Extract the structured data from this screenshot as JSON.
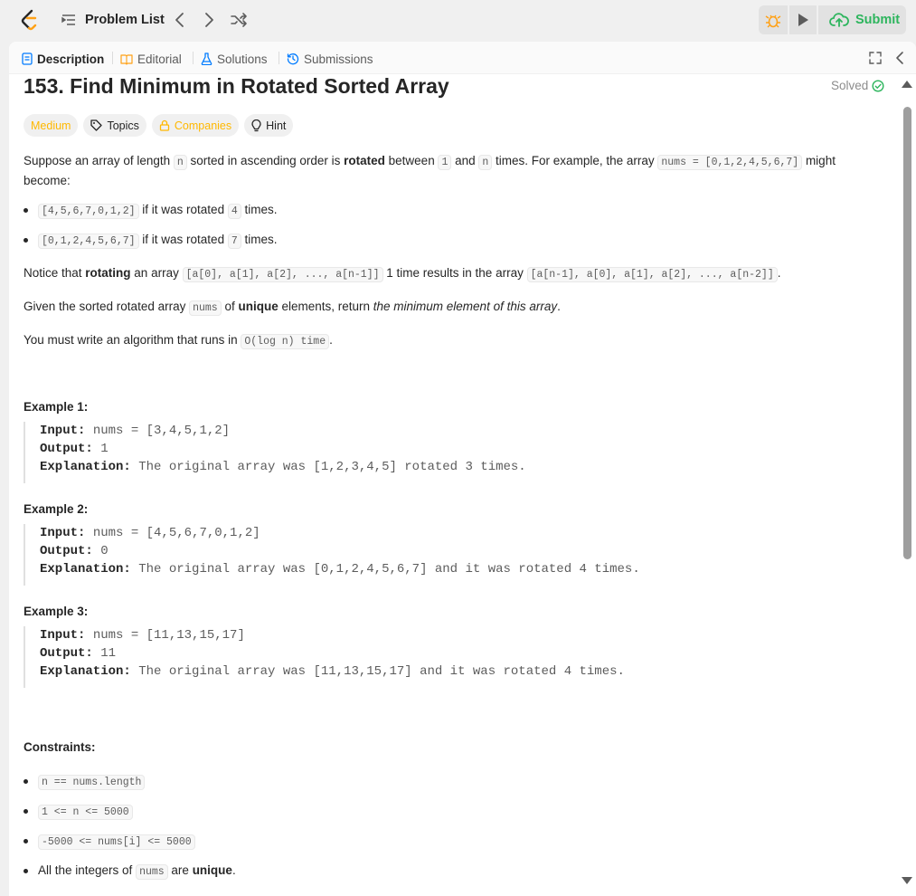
{
  "topbar": {
    "problem_list_label": "Problem List",
    "submit_label": "Submit",
    "submit_color": "#2db55d",
    "accent_color": "#ffa116"
  },
  "tabs": [
    {
      "label": "Description",
      "icon": "description-icon",
      "active": true
    },
    {
      "label": "Editorial",
      "icon": "book-icon"
    },
    {
      "label": "Solutions",
      "icon": "flask-icon"
    },
    {
      "label": "Submissions",
      "icon": "history-icon"
    }
  ],
  "problem": {
    "title": "153. Find Minimum in Rotated Sorted Array",
    "status": "Solved",
    "difficulty": "Medium",
    "topics_label": "Topics",
    "companies_label": "Companies",
    "hint_label": "Hint"
  },
  "description": {
    "p1": {
      "t1": "Suppose an array of length ",
      "c1": "n",
      "t2": " sorted in ascending order is ",
      "b1": "rotated",
      "t3": " between ",
      "c2": "1",
      "t4": " and ",
      "c3": "n",
      "t5": " times. For example, the array ",
      "c4": "nums = [0,1,2,4,5,6,7]",
      "t6": " might become:"
    },
    "bullets": [
      {
        "code": "[4,5,6,7,0,1,2]",
        "text": " if it was rotated ",
        "n": "4",
        "tail": " times."
      },
      {
        "code": "[0,1,2,4,5,6,7]",
        "text": " if it was rotated ",
        "n": "7",
        "tail": " times."
      }
    ],
    "p2": {
      "t1": "Notice that ",
      "b1": "rotating",
      "t2": " an array ",
      "c1": "[a[0], a[1], a[2], ..., a[n-1]]",
      "t3": " 1 time results in the array ",
      "c2": "[a[n-1], a[0], a[1], a[2], ..., a[n-2]]",
      "t4": "."
    },
    "p3": {
      "t1": "Given the sorted rotated array ",
      "c1": "nums",
      "t2": " of ",
      "b1": "unique",
      "t3": " elements, return ",
      "i1": "the minimum element of this array",
      "t4": "."
    },
    "p4": {
      "t1": "You must write an algorithm that runs in ",
      "c1": "O(log n) time",
      "t2": "."
    }
  },
  "examples": [
    {
      "heading": "Example 1:",
      "input_label": "Input:",
      "input": " nums = [3,4,5,1,2]",
      "output_label": "Output:",
      "output": " 1",
      "explanation_label": "Explanation:",
      "explanation": " The original array was [1,2,3,4,5] rotated 3 times."
    },
    {
      "heading": "Example 2:",
      "input_label": "Input:",
      "input": " nums = [4,5,6,7,0,1,2]",
      "output_label": "Output:",
      "output": " 0",
      "explanation_label": "Explanation:",
      "explanation": " The original array was [0,1,2,4,5,6,7] and it was rotated 4 times."
    },
    {
      "heading": "Example 3:",
      "input_label": "Input:",
      "input": " nums = [11,13,15,17]",
      "output_label": "Output:",
      "output": " 11",
      "explanation_label": "Explanation:",
      "explanation": " The original array was [11,13,15,17] and it was rotated 4 times."
    }
  ],
  "constraints": {
    "heading": "Constraints:",
    "items": [
      "n == nums.length",
      "1 <= n <= 5000",
      "-5000 <= nums[i] <= 5000"
    ],
    "last": {
      "t1": "All the integers of ",
      "c1": "nums",
      "t2": " are ",
      "b1": "unique",
      "t3": "."
    }
  }
}
